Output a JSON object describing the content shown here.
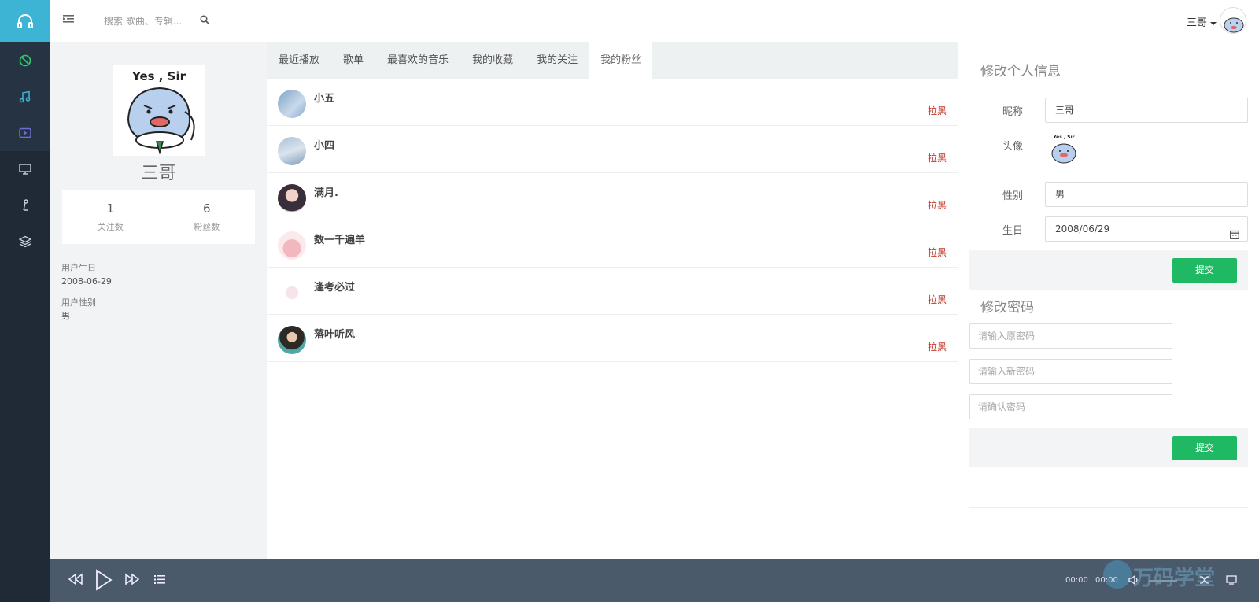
{
  "topbar": {
    "search_placeholder": "搜索 歌曲、专辑...",
    "user_name": "三哥"
  },
  "rail": {
    "icons": [
      "headphones-icon",
      "disc-icon",
      "music-note-icon",
      "video-icon",
      "monitor-icon",
      "mic-icon",
      "layers-icon"
    ]
  },
  "profile": {
    "sticker_text": "Yes , Sir",
    "name": "三哥",
    "following_count": "1",
    "following_label": "关注数",
    "fans_count": "6",
    "fans_label": "粉丝数",
    "birthday_label": "用户生日",
    "birthday_value": "2008-06-29",
    "gender_label": "用户性别",
    "gender_value": "男"
  },
  "tabs": [
    "最近播放",
    "歌单",
    "最喜欢的音乐",
    "我的收藏",
    "我的关注",
    "我的粉丝"
  ],
  "active_tab": "我的粉丝",
  "fans": [
    {
      "name": "小五",
      "action": "拉黑"
    },
    {
      "name": "小四",
      "action": "拉黑"
    },
    {
      "name": "满月.",
      "action": "拉黑"
    },
    {
      "name": "数一千遍羊",
      "action": "拉黑"
    },
    {
      "name": "逢考必过",
      "action": "拉黑"
    },
    {
      "name": "落叶听风",
      "action": "拉黑"
    }
  ],
  "settings": {
    "info_title": "修改个人信息",
    "nickname_label": "昵称",
    "nickname_value": "三哥",
    "avatar_label": "头像",
    "gender_label": "性别",
    "gender_value": "男",
    "birthday_label": "生日",
    "birthday_value": "2008/06/29",
    "submit_label": "提交",
    "password_title": "修改密码",
    "old_password_placeholder": "请输入原密码",
    "new_password_placeholder": "请输入新密码",
    "confirm_password_placeholder": "请确认密码",
    "submit2_label": "提交"
  },
  "player": {
    "current_time": "00:00",
    "duration": "00:00",
    "watermark": "万码学堂"
  },
  "colors": {
    "rail_bg": "#1f2a36",
    "logo_bg": "#3eb4d5",
    "accent_green": "#1fb863",
    "block_red": "#c0392b",
    "player_bg": "#4a5a6a"
  }
}
